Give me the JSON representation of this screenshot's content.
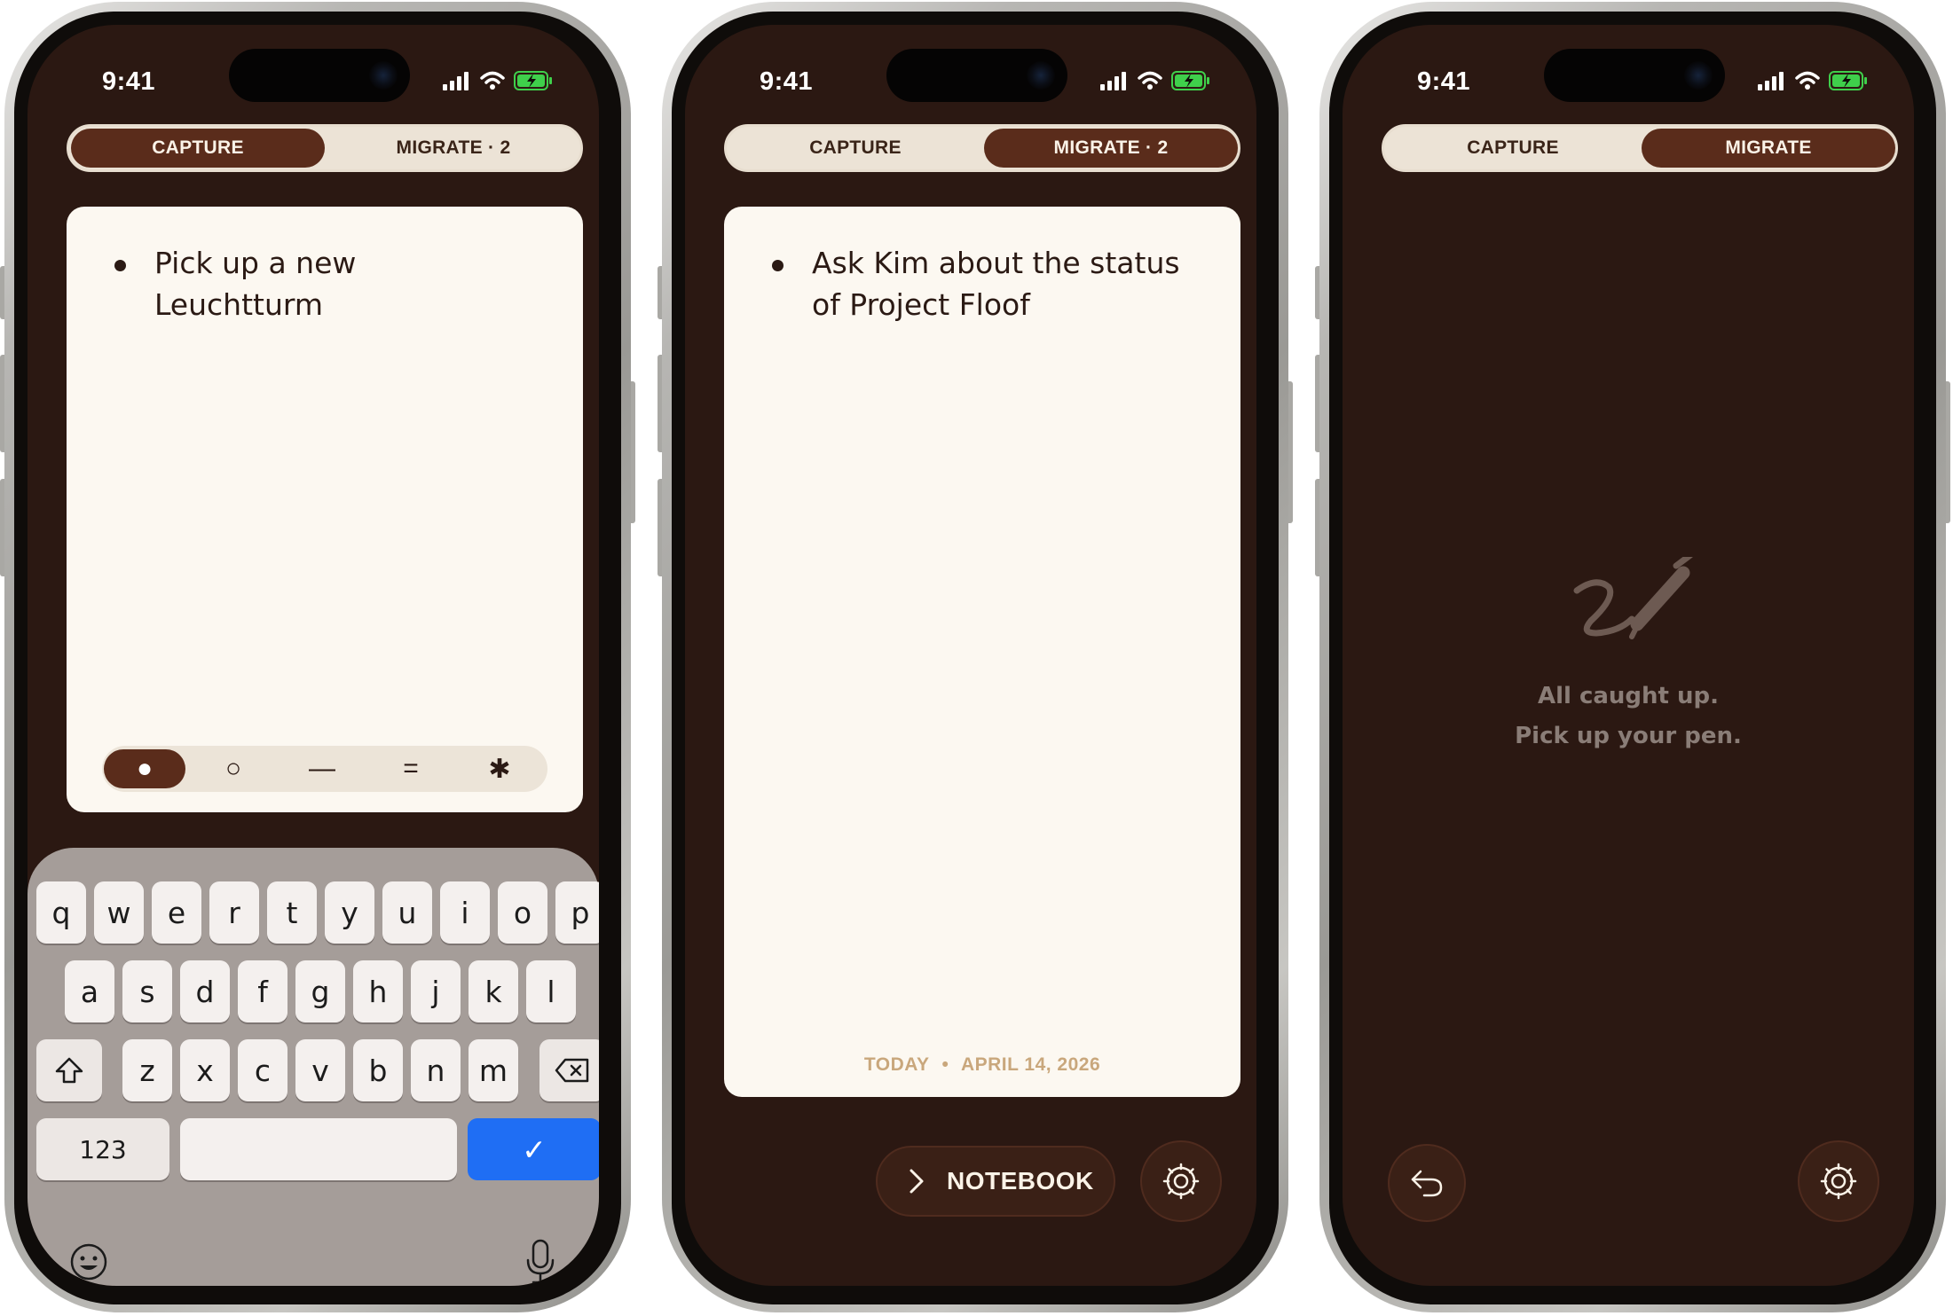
{
  "status_bar": {
    "time": "9:41"
  },
  "phones": [
    {
      "tabs": {
        "capture": "CAPTURE",
        "migrate": "MIGRATE · 2"
      },
      "note_text": "Pick up a new Leuchtturm",
      "bullet_picker": [
        "●",
        "○",
        "—",
        "=",
        "✱"
      ],
      "keyboard": {
        "row1": [
          "q",
          "w",
          "e",
          "r",
          "t",
          "y",
          "u",
          "i",
          "o",
          "p"
        ],
        "row2": [
          "a",
          "s",
          "d",
          "f",
          "g",
          "h",
          "j",
          "k",
          "l"
        ],
        "row3": [
          "z",
          "x",
          "c",
          "v",
          "b",
          "n",
          "m"
        ],
        "numbers_key": "123",
        "confirm_key": "✓"
      }
    },
    {
      "tabs": {
        "capture": "CAPTURE",
        "migrate": "MIGRATE · 2"
      },
      "note_text": "Ask Kim about the status of Project Floof",
      "date_label": "TODAY",
      "date_sep": "•",
      "date_value": "APRIL 14, 2026",
      "notebook_label": "NOTEBOOK"
    },
    {
      "tabs": {
        "capture": "CAPTURE",
        "migrate": "MIGRATE"
      },
      "empty_line1": "All caught up.",
      "empty_line2": "Pick up your pen."
    }
  ],
  "colors": {
    "background": "#2b1812",
    "accent": "#5a2c1b",
    "card": "#fcf8f1",
    "date_text": "#c9a77c",
    "keyboard_confirm": "#1f6ef4"
  },
  "icons": {
    "signal": "signal-icon",
    "wifi": "wifi-icon",
    "battery": "battery-charging-icon",
    "shift": "shift-icon",
    "delete": "delete-icon",
    "emoji": "emoji-icon",
    "mic": "mic-icon",
    "chevron": "chevron-right-icon",
    "settings": "settings-icon",
    "undo": "undo-icon",
    "pen": "pen-scribble-icon"
  }
}
